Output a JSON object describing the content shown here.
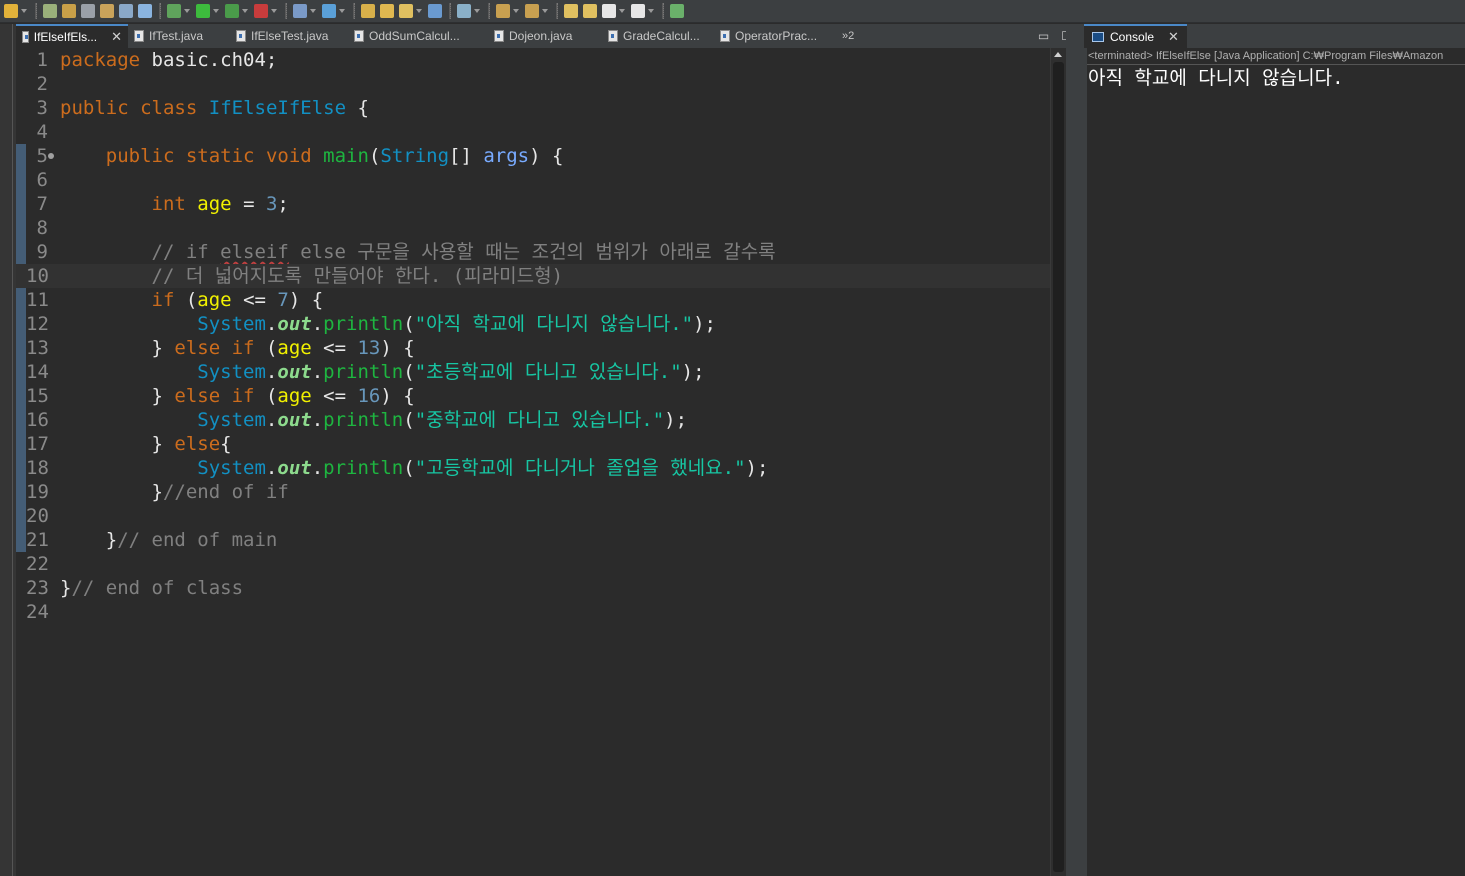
{
  "toolbar": {
    "buttons": [
      {
        "name": "pin-icon",
        "color": "#e2b23a",
        "drop": true
      },
      {
        "name": "breakpoint-icon",
        "color": "#9ab07a",
        "drop": false
      },
      {
        "name": "pencil-icon",
        "color": "#c9a048",
        "drop": false
      },
      {
        "name": "tools-icon",
        "color": "#9aa0a8",
        "drop": false
      },
      {
        "name": "edit-doc-icon",
        "color": "#caa35a",
        "drop": false
      },
      {
        "name": "document-icon",
        "color": "#8aa8c8",
        "drop": false
      },
      {
        "name": "paragraph-icon",
        "color": "#8ab4e0",
        "drop": false
      },
      {
        "name": "debug-icon",
        "color": "#5fa35c",
        "drop": true
      },
      {
        "name": "run-icon",
        "color": "#3dbb3d",
        "drop": true
      },
      {
        "name": "run-config-icon",
        "color": "#4a9b4a",
        "drop": true
      },
      {
        "name": "stop-icon",
        "color": "#c83c3c",
        "drop": true
      },
      {
        "name": "new-wizard-icon",
        "color": "#7a9ac8",
        "drop": true
      },
      {
        "name": "new-class-icon",
        "color": "#5aa0d8",
        "drop": true
      },
      {
        "name": "open-folder-icon",
        "color": "#d8b04a",
        "drop": false
      },
      {
        "name": "folder-icon",
        "color": "#e0b850",
        "drop": false
      },
      {
        "name": "brush-icon",
        "color": "#e0c060",
        "drop": true
      },
      {
        "name": "globe-icon",
        "color": "#6a9ad0",
        "drop": false
      },
      {
        "name": "search-icon",
        "color": "#8ab0c8",
        "drop": true
      },
      {
        "name": "next-annotation-icon",
        "color": "#c8a050",
        "drop": true
      },
      {
        "name": "prev-annotation-icon",
        "color": "#c8a050",
        "drop": true
      },
      {
        "name": "back-edit-icon",
        "color": "#e0c060",
        "drop": false
      },
      {
        "name": "forward-edit-icon",
        "color": "#e0c060",
        "drop": false
      },
      {
        "name": "back-icon",
        "color": "#e6e6e6",
        "drop": true
      },
      {
        "name": "forward-icon",
        "color": "#e6e6e6",
        "drop": true
      },
      {
        "name": "task-icon",
        "color": "#6ab06a",
        "drop": false
      }
    ]
  },
  "editor_tabs": {
    "items": [
      {
        "label": "IfElseIfEls...",
        "active": true
      },
      {
        "label": "IfTest.java",
        "active": false
      },
      {
        "label": "IfElseTest.java",
        "active": false
      },
      {
        "label": "OddSumCalcul...",
        "active": false
      },
      {
        "label": "Dojeon.java",
        "active": false
      },
      {
        "label": "GradeCalcul...",
        "active": false
      },
      {
        "label": "OperatorPrac...",
        "active": false
      }
    ],
    "overflow": "»2",
    "minimize": "▭",
    "maximize": "☐"
  },
  "editor": {
    "current_line": 10,
    "lines": [
      {
        "n": "1",
        "tokens": [
          [
            "kw",
            "package"
          ],
          [
            "",
            "&nbsp;basic.ch04;"
          ]
        ]
      },
      {
        "n": "2",
        "tokens": []
      },
      {
        "n": "3",
        "tokens": [
          [
            "kw",
            "public"
          ],
          [
            "",
            "&nbsp;"
          ],
          [
            "kw",
            "class"
          ],
          [
            "",
            "&nbsp;"
          ],
          [
            "cls",
            "IfElseIfElse"
          ],
          [
            "",
            "&nbsp;{"
          ]
        ]
      },
      {
        "n": "4",
        "tokens": []
      },
      {
        "n": "5",
        "marker": true,
        "tokens": [
          [
            "",
            "    "
          ],
          [
            "kw",
            "public"
          ],
          [
            "",
            "&nbsp;"
          ],
          [
            "kw",
            "static"
          ],
          [
            "",
            "&nbsp;"
          ],
          [
            "kw",
            "void"
          ],
          [
            "",
            "&nbsp;"
          ],
          [
            "mname",
            "main"
          ],
          [
            "",
            "("
          ],
          [
            "cls",
            "String"
          ],
          [
            "",
            "[]&nbsp;"
          ],
          [
            "param",
            "args"
          ],
          [
            "",
            ")&nbsp;{"
          ]
        ]
      },
      {
        "n": "6",
        "tokens": []
      },
      {
        "n": "7",
        "tokens": [
          [
            "",
            "        "
          ],
          [
            "kw",
            "int"
          ],
          [
            "",
            "&nbsp;"
          ],
          [
            "var",
            "age"
          ],
          [
            "",
            "&nbsp;=&nbsp;"
          ],
          [
            "num",
            "3"
          ],
          [
            "",
            ";"
          ]
        ]
      },
      {
        "n": "8",
        "tokens": []
      },
      {
        "n": "9",
        "tokens": [
          [
            "",
            "        "
          ],
          [
            "comment",
            "// if "
          ],
          [
            "comment squiggle",
            "elseif"
          ],
          [
            "comment",
            " else 구문을 사용할 때는 조건의 범위가 아래로 갈수록"
          ]
        ]
      },
      {
        "n": "10",
        "tokens": [
          [
            "",
            "        "
          ],
          [
            "comment",
            "// 더 넓어지도록 만들어야 한다. (피라미드형)"
          ]
        ]
      },
      {
        "n": "11",
        "tokens": [
          [
            "",
            "        "
          ],
          [
            "kw",
            "if"
          ],
          [
            "",
            "&nbsp;("
          ],
          [
            "var",
            "age"
          ],
          [
            "",
            "&nbsp;&lt;=&nbsp;"
          ],
          [
            "num",
            "7"
          ],
          [
            "",
            ")&nbsp;{"
          ]
        ]
      },
      {
        "n": "12",
        "tokens": [
          [
            "",
            "            "
          ],
          [
            "cls",
            "System"
          ],
          [
            "",
            "."
          ],
          [
            "field",
            "out"
          ],
          [
            "",
            "."
          ],
          [
            "mname",
            "println"
          ],
          [
            "",
            "("
          ],
          [
            "str",
            "\"아직 학교에 다니지 않습니다.\""
          ],
          [
            "",
            ");"
          ]
        ]
      },
      {
        "n": "13",
        "tokens": [
          [
            "",
            "        }&nbsp;"
          ],
          [
            "kw",
            "else"
          ],
          [
            "",
            "&nbsp;"
          ],
          [
            "kw",
            "if"
          ],
          [
            "",
            "&nbsp;("
          ],
          [
            "var",
            "age"
          ],
          [
            "",
            "&nbsp;&lt;=&nbsp;"
          ],
          [
            "num",
            "13"
          ],
          [
            "",
            ")&nbsp;{"
          ]
        ]
      },
      {
        "n": "14",
        "tokens": [
          [
            "",
            "            "
          ],
          [
            "cls",
            "System"
          ],
          [
            "",
            "."
          ],
          [
            "field",
            "out"
          ],
          [
            "",
            "."
          ],
          [
            "mname",
            "println"
          ],
          [
            "",
            "("
          ],
          [
            "str",
            "\"초등학교에 다니고 있습니다.\""
          ],
          [
            "",
            ");"
          ]
        ]
      },
      {
        "n": "15",
        "tokens": [
          [
            "",
            "        }&nbsp;"
          ],
          [
            "kw",
            "else"
          ],
          [
            "",
            "&nbsp;"
          ],
          [
            "kw",
            "if"
          ],
          [
            "",
            "&nbsp;("
          ],
          [
            "var",
            "age"
          ],
          [
            "",
            "&nbsp;&lt;=&nbsp;"
          ],
          [
            "num",
            "16"
          ],
          [
            "",
            ")&nbsp;{"
          ]
        ]
      },
      {
        "n": "16",
        "tokens": [
          [
            "",
            "            "
          ],
          [
            "cls",
            "System"
          ],
          [
            "",
            "."
          ],
          [
            "field",
            "out"
          ],
          [
            "",
            "."
          ],
          [
            "mname",
            "println"
          ],
          [
            "",
            "("
          ],
          [
            "str",
            "\"중학교에 다니고 있습니다.\""
          ],
          [
            "",
            ");"
          ]
        ]
      },
      {
        "n": "17",
        "tokens": [
          [
            "",
            "        }&nbsp;"
          ],
          [
            "kw",
            "else"
          ],
          [
            "",
            "{"
          ]
        ]
      },
      {
        "n": "18",
        "tokens": [
          [
            "",
            "            "
          ],
          [
            "cls",
            "System"
          ],
          [
            "",
            "."
          ],
          [
            "field",
            "out"
          ],
          [
            "",
            "."
          ],
          [
            "mname",
            "println"
          ],
          [
            "",
            "("
          ],
          [
            "str",
            "\"고등학교에 다니거나 졸업을 했네요.\""
          ],
          [
            "",
            ");"
          ]
        ]
      },
      {
        "n": "19",
        "tokens": [
          [
            "",
            "        }"
          ],
          [
            "comment",
            "//end of if"
          ]
        ]
      },
      {
        "n": "20",
        "tokens": []
      },
      {
        "n": "21",
        "tokens": [
          [
            "",
            "    }"
          ],
          [
            "comment",
            "// end of main"
          ]
        ]
      },
      {
        "n": "22",
        "tokens": []
      },
      {
        "n": "23",
        "tokens": [
          [
            "",
            "}"
          ],
          [
            "comment",
            "// end of class"
          ]
        ]
      },
      {
        "n": "24",
        "tokens": []
      }
    ]
  },
  "console": {
    "tab_label": "Console",
    "status": "<terminated> IfElseIfElse [Java Application] C:₩Program Files₩Amazon",
    "output": "아직 학교에 다니지 않습니다."
  }
}
